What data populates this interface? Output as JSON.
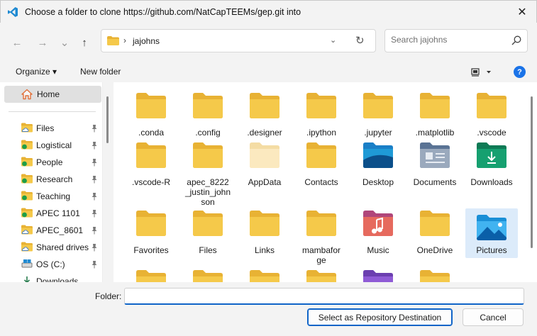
{
  "window": {
    "title": "Choose a folder to clone https://github.com/NatCapTEEMs/gep.git into",
    "close_glyph": "✕"
  },
  "nav": {
    "back_glyph": "←",
    "forward_glyph": "→",
    "recent_glyph": "⌄",
    "up_glyph": "↑",
    "address_separator": "›",
    "address_path": "jajohns",
    "address_dropdown_glyph": "⌄",
    "refresh_glyph": "↻",
    "search_placeholder": "Search jajohns"
  },
  "commands": {
    "organize": "Organize ▾",
    "new_folder": "New folder",
    "help": "?"
  },
  "sidebar": {
    "home": "Home",
    "items": [
      {
        "label": "Files",
        "status": "cloud"
      },
      {
        "label": "Logistical",
        "status": "synced"
      },
      {
        "label": "People",
        "status": "synced"
      },
      {
        "label": "Research",
        "status": "synced"
      },
      {
        "label": "Teaching",
        "status": "synced"
      },
      {
        "label": "APEC 1101",
        "status": "synced"
      },
      {
        "label": "APEC_8601",
        "status": "cloud"
      },
      {
        "label": "Shared drives",
        "status": "cloud"
      },
      {
        "label": "OS (C:)",
        "status": "drive"
      },
      {
        "label": "Downloads",
        "status": "download"
      }
    ]
  },
  "folders": [
    {
      "label": ".conda",
      "icon": "folder"
    },
    {
      "label": ".config",
      "icon": "folder"
    },
    {
      "label": ".designer",
      "icon": "folder"
    },
    {
      "label": ".ipython",
      "icon": "folder"
    },
    {
      "label": ".jupyter",
      "icon": "folder"
    },
    {
      "label": ".matplotlib",
      "icon": "folder"
    },
    {
      "label": ".vscode",
      "icon": "folder"
    },
    {
      "label": ".vscode-R",
      "icon": "folder"
    },
    {
      "label": "apec_8222_justin_johnson",
      "icon": "folder"
    },
    {
      "label": "AppData",
      "icon": "folder-hidden"
    },
    {
      "label": "Contacts",
      "icon": "folder"
    },
    {
      "label": "Desktop",
      "icon": "desktop-folder"
    },
    {
      "label": "Documents",
      "icon": "documents-folder"
    },
    {
      "label": "Downloads",
      "icon": "downloads-folder"
    },
    {
      "label": "Favorites",
      "icon": "folder"
    },
    {
      "label": "Files",
      "icon": "folder"
    },
    {
      "label": "Links",
      "icon": "folder"
    },
    {
      "label": "mambaforge",
      "icon": "folder"
    },
    {
      "label": "Music",
      "icon": "music-folder"
    },
    {
      "label": "OneDrive",
      "icon": "folder"
    },
    {
      "label": "Pictures",
      "icon": "pictures-folder",
      "selected": true
    },
    {
      "label": "",
      "icon": "folder"
    },
    {
      "label": "",
      "icon": "folder"
    },
    {
      "label": "",
      "icon": "folder"
    },
    {
      "label": "",
      "icon": "folder"
    },
    {
      "label": "",
      "icon": "videos-folder"
    },
    {
      "label": "",
      "icon": "folder"
    }
  ],
  "footer": {
    "folder_label": "Folder:",
    "folder_value": "",
    "select_button": "Select as Repository Destination",
    "cancel_button": "Cancel"
  },
  "colors": {
    "folder_yellow": "#f5c94a",
    "folder_back": "#e8b234",
    "accent": "#0f64c8",
    "selected_tile": "#dcebfa"
  }
}
